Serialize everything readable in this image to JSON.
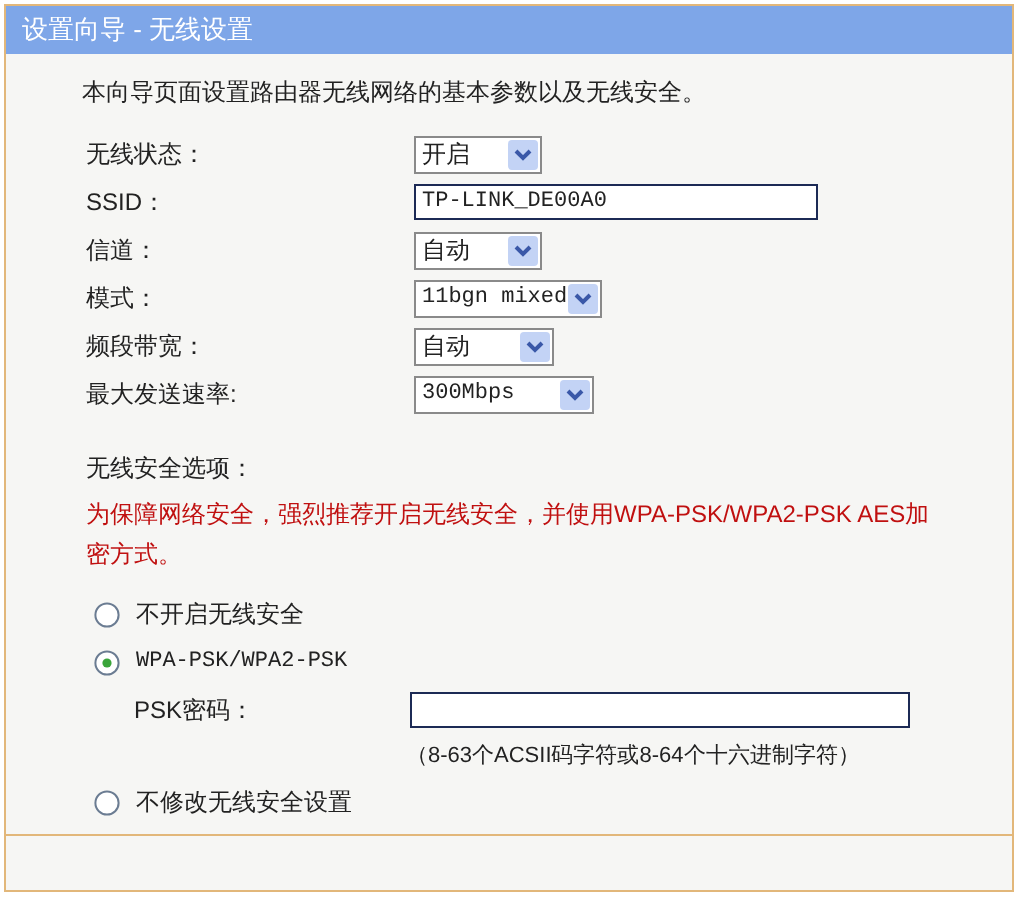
{
  "window": {
    "title": "设置向导 - 无线设置"
  },
  "intro": "本向导页面设置路由器无线网络的基本参数以及无线安全。",
  "settings": [
    {
      "label": "无线状态：",
      "kind": "select",
      "value": "开启"
    },
    {
      "label": "SSID：",
      "kind": "text",
      "value": "TP-LINK_DE00A0"
    },
    {
      "label": "信道：",
      "kind": "select",
      "value": "自动"
    },
    {
      "label": "模式：",
      "kind": "select",
      "value": "11bgn mixed"
    },
    {
      "label": "频段带宽：",
      "kind": "select",
      "value": "自动"
    },
    {
      "label": "最大发送速率:",
      "kind": "select",
      "value": "300Mbps"
    }
  ],
  "security": {
    "heading": "无线安全选项：",
    "warning": "为保障网络安全，强烈推荐开启无线安全，并使用WPA-PSK/WPA2-PSK AES加密方式。",
    "options": [
      {
        "label": "不开启无线安全",
        "selected": false
      },
      {
        "label": "WPA-PSK/WPA2-PSK",
        "selected": true,
        "password_label": "PSK密码：",
        "hint": "（8-63个ACSII码字符或8-64个十六进制字符）"
      },
      {
        "label": "不修改无线安全设置",
        "selected": false
      }
    ]
  }
}
